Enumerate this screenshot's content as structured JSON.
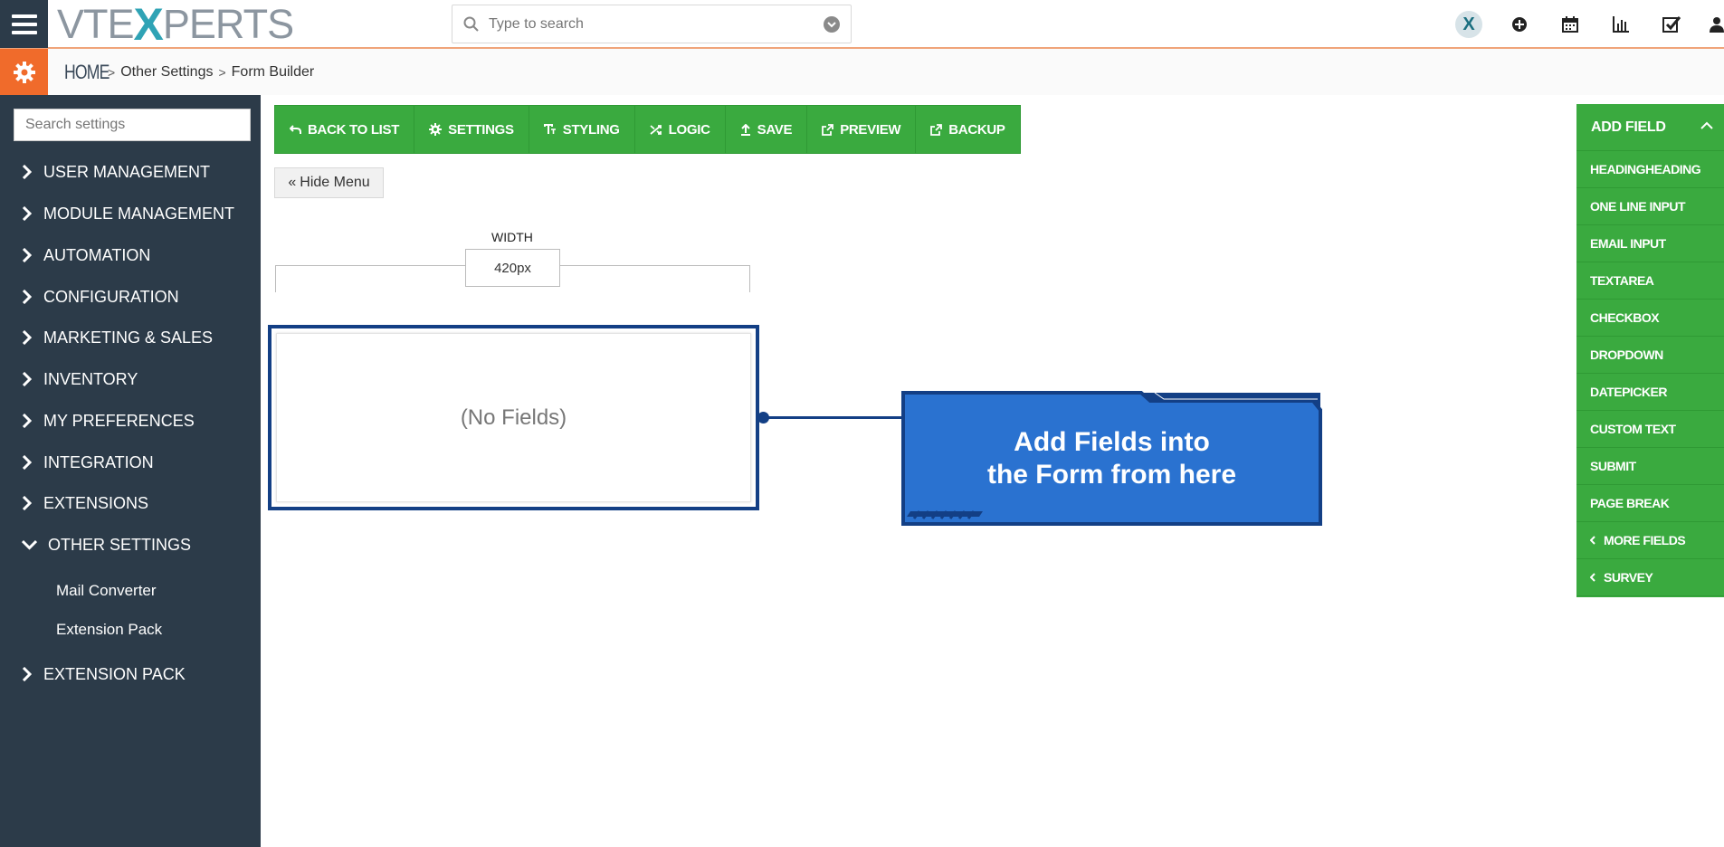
{
  "header": {
    "logo_vt": "VTE",
    "logo_x": "X",
    "logo_perts": "PERTS",
    "search_placeholder": "Type to search"
  },
  "breadcrumb": {
    "home": "HOME",
    "level1": "Other Settings",
    "level2": "Form Builder"
  },
  "sidebar": {
    "search_placeholder": "Search settings",
    "items": [
      {
        "label": "USER MANAGEMENT"
      },
      {
        "label": "MODULE MANAGEMENT"
      },
      {
        "label": "AUTOMATION"
      },
      {
        "label": "CONFIGURATION"
      },
      {
        "label": "MARKETING & SALES"
      },
      {
        "label": "INVENTORY"
      },
      {
        "label": "MY PREFERENCES"
      },
      {
        "label": "INTEGRATION"
      },
      {
        "label": "EXTENSIONS"
      },
      {
        "label": "OTHER SETTINGS"
      },
      {
        "label": "EXTENSION PACK"
      }
    ],
    "subitems": [
      {
        "label": "Mail Converter"
      },
      {
        "label": "Extension Pack"
      }
    ]
  },
  "toolbar": {
    "back": "BACK TO LIST",
    "settings": "SETTINGS",
    "styling": "STYLING",
    "logic": "LOGIC",
    "save": "SAVE",
    "preview": "PREVIEW",
    "backup": "BACKUP"
  },
  "hide_menu": "Hide Menu",
  "width": {
    "label": "WIDTH",
    "value": "420px"
  },
  "form": {
    "empty_text": "(No Fields)"
  },
  "callout": {
    "line1": "Add Fields into",
    "line2": "the Form from here"
  },
  "add_field": {
    "title": "ADD FIELD",
    "items": [
      {
        "label": "HEADINGHEADING"
      },
      {
        "label": "ONE LINE INPUT"
      },
      {
        "label": "EMAIL INPUT"
      },
      {
        "label": "TEXTAREA"
      },
      {
        "label": "CHECKBOX"
      },
      {
        "label": "DROPDOWN"
      },
      {
        "label": "DATEPICKER"
      },
      {
        "label": "CUSTOM TEXT"
      },
      {
        "label": "SUBMIT"
      },
      {
        "label": "PAGE BREAK"
      },
      {
        "label": "MORE FIELDS"
      },
      {
        "label": "SURVEY"
      }
    ]
  },
  "colors": {
    "sidebar_bg": "#2c3b49",
    "accent_orange": "#f06b2b",
    "toolbar_green": "#3aaa3f",
    "callout_blue": "#2a72d0",
    "frame_navy": "#133f85"
  }
}
